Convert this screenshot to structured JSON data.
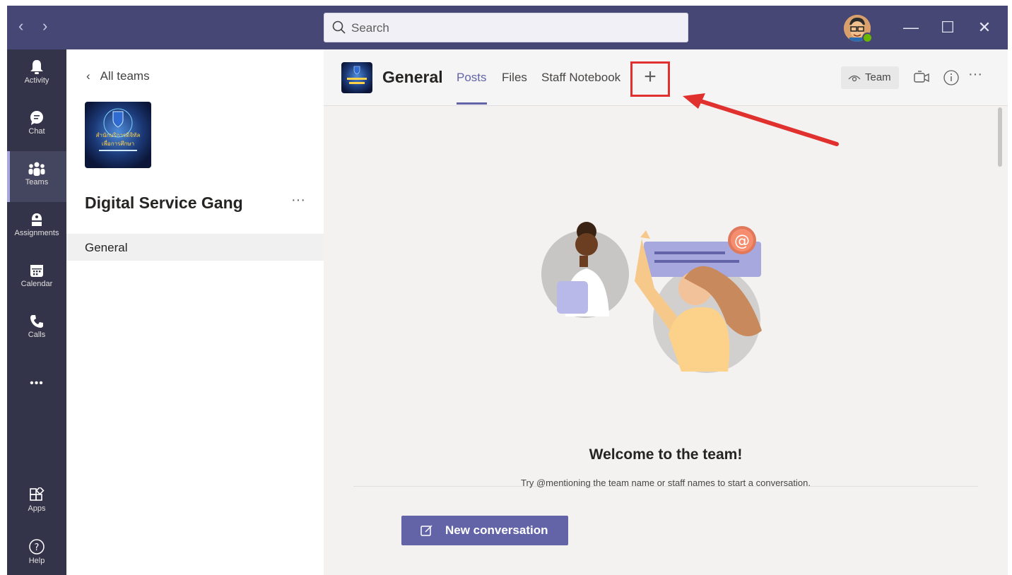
{
  "search": {
    "placeholder": "Search"
  },
  "rail": {
    "items": [
      {
        "label": "Activity",
        "icon": "bell-icon"
      },
      {
        "label": "Chat",
        "icon": "chat-icon"
      },
      {
        "label": "Teams",
        "icon": "teams-icon",
        "active": true
      },
      {
        "label": "Assignments",
        "icon": "assignments-icon"
      },
      {
        "label": "Calendar",
        "icon": "calendar-icon"
      },
      {
        "label": "Calls",
        "icon": "phone-icon"
      },
      {
        "label": "Apps",
        "icon": "apps-icon"
      },
      {
        "label": "Help",
        "icon": "help-icon"
      }
    ],
    "more": "•••"
  },
  "left_pane": {
    "back_label": "All teams",
    "team_name": "Digital Service Gang",
    "more": "···",
    "channels": [
      "General"
    ],
    "team_image_text": [
      "สำนักบริการดิจิทัล",
      "เพื่อการศึกษา"
    ]
  },
  "channel_header": {
    "title": "General",
    "tabs": [
      "Posts",
      "Files",
      "Staff Notebook"
    ],
    "active_tab": "Posts",
    "add_tab": "+",
    "team_button": "Team",
    "more": "···"
  },
  "content": {
    "welcome_title": "Welcome to the team!",
    "welcome_sub": "Try @mentioning the team name or staff names to start a conversation.",
    "new_conversation": "New conversation"
  },
  "colors": {
    "titlebar": "#464775",
    "rail": "#33344a",
    "accent": "#6264a7",
    "highlight_box": "#e0312f"
  }
}
